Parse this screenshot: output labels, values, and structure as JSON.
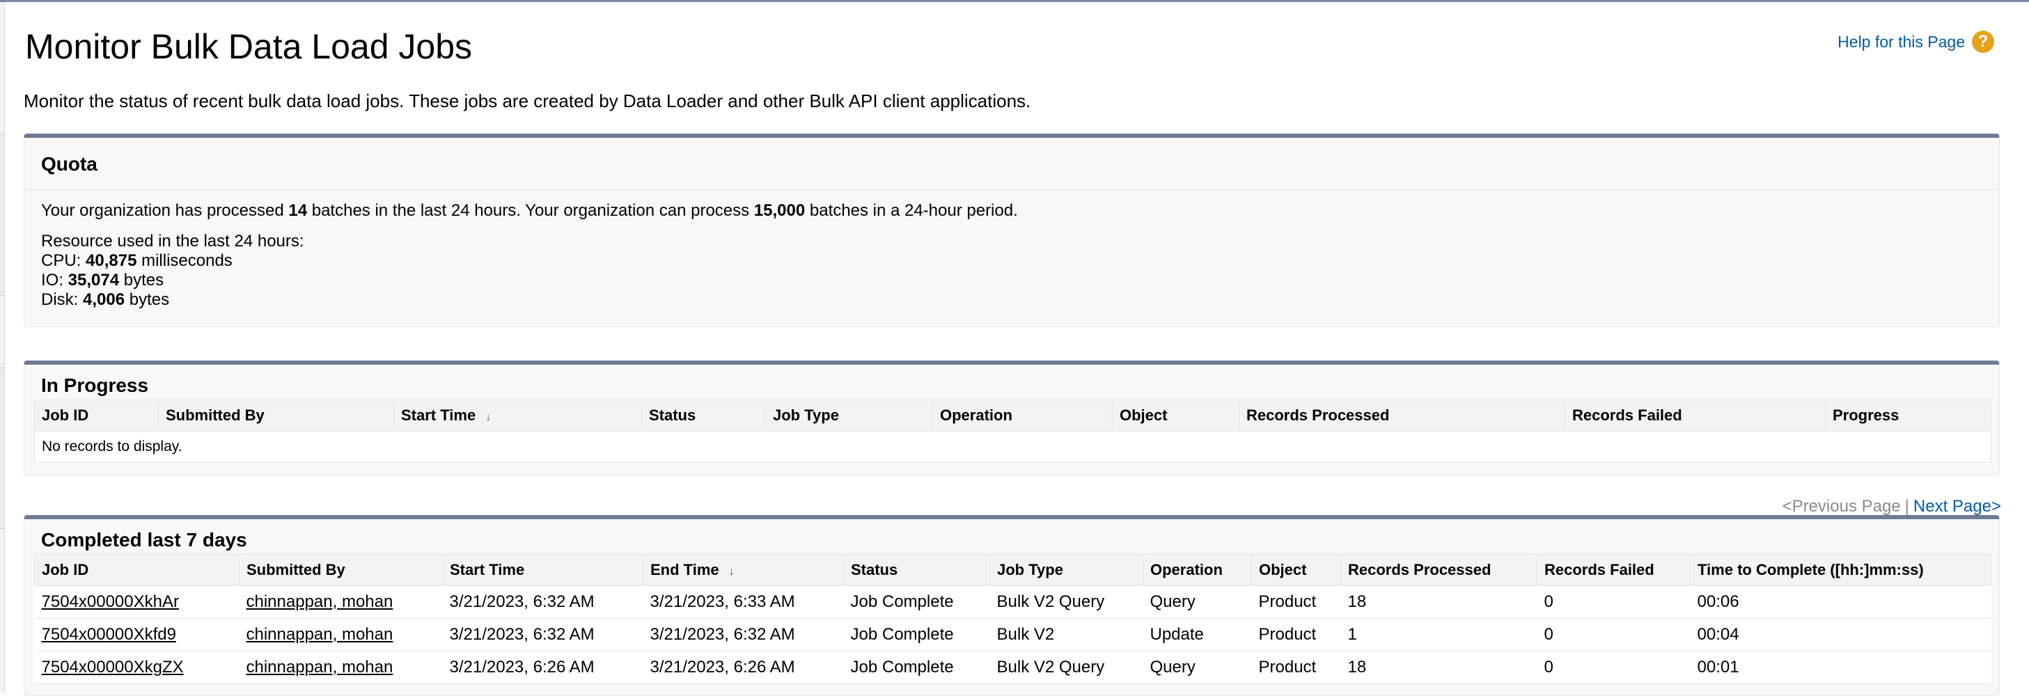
{
  "page": {
    "title": "Monitor Bulk Data Load Jobs",
    "help_link": "Help for this Page",
    "help_icon_glyph": "?",
    "description": "Monitor the status of recent bulk data load jobs. These jobs are created by Data Loader and other Bulk API client applications."
  },
  "quota": {
    "title": "Quota",
    "line1_a": "Your organization has processed ",
    "batches_processed": "14",
    "line1_b": " batches in the last 24 hours. Your organization can process ",
    "batch_limit": "15,000",
    "line1_c": " batches in a 24-hour period.",
    "resource_heading": "Resource used in the last 24 hours:",
    "cpu_label": "CPU: ",
    "cpu_value": "40,875",
    "cpu_unit": " milliseconds",
    "io_label": "IO: ",
    "io_value": "35,074",
    "io_unit": " bytes",
    "disk_label": "Disk: ",
    "disk_value": "4,006",
    "disk_unit": " bytes"
  },
  "in_progress": {
    "title": "In Progress",
    "columns": [
      "Job ID",
      "Submitted By",
      "Start Time",
      "Status",
      "Job Type",
      "Operation",
      "Object",
      "Records Processed",
      "Records Failed",
      "Progress"
    ],
    "sort_glyph": "↓",
    "empty_message": "No records to display."
  },
  "pager": {
    "previous": "<Previous Page",
    "separator": "|",
    "next": "Next Page>"
  },
  "completed": {
    "title": "Completed last 7 days",
    "columns": [
      "Job ID",
      "Submitted By",
      "Start Time",
      "End Time",
      "Status",
      "Job Type",
      "Operation",
      "Object",
      "Records Processed",
      "Records Failed",
      "Time to Complete ([hh:]mm:ss)"
    ],
    "sort_glyph": "↓",
    "rows": [
      {
        "job_id": "7504x00000XkhAr",
        "submitted_by": "chinnappan, mohan",
        "start_time": "3/21/2023, 6:32 AM",
        "end_time": "3/21/2023, 6:33 AM",
        "status": "Job Complete",
        "job_type": "Bulk V2 Query",
        "operation": "Query",
        "object": "Product",
        "records_processed": "18",
        "records_failed": "0",
        "time_to_complete": "00:06"
      },
      {
        "job_id": "7504x00000Xkfd9",
        "submitted_by": "chinnappan, mohan",
        "start_time": "3/21/2023, 6:32 AM",
        "end_time": "3/21/2023, 6:32 AM",
        "status": "Job Complete",
        "job_type": "Bulk V2",
        "operation": "Update",
        "object": "Product",
        "records_processed": "1",
        "records_failed": "0",
        "time_to_complete": "00:04"
      },
      {
        "job_id": "7504x00000XkgZX",
        "submitted_by": "chinnappan, mohan",
        "start_time": "3/21/2023, 6:26 AM",
        "end_time": "3/21/2023, 6:26 AM",
        "status": "Job Complete",
        "job_type": "Bulk V2 Query",
        "operation": "Query",
        "object": "Product",
        "records_processed": "18",
        "records_failed": "0",
        "time_to_complete": "00:01"
      }
    ]
  }
}
